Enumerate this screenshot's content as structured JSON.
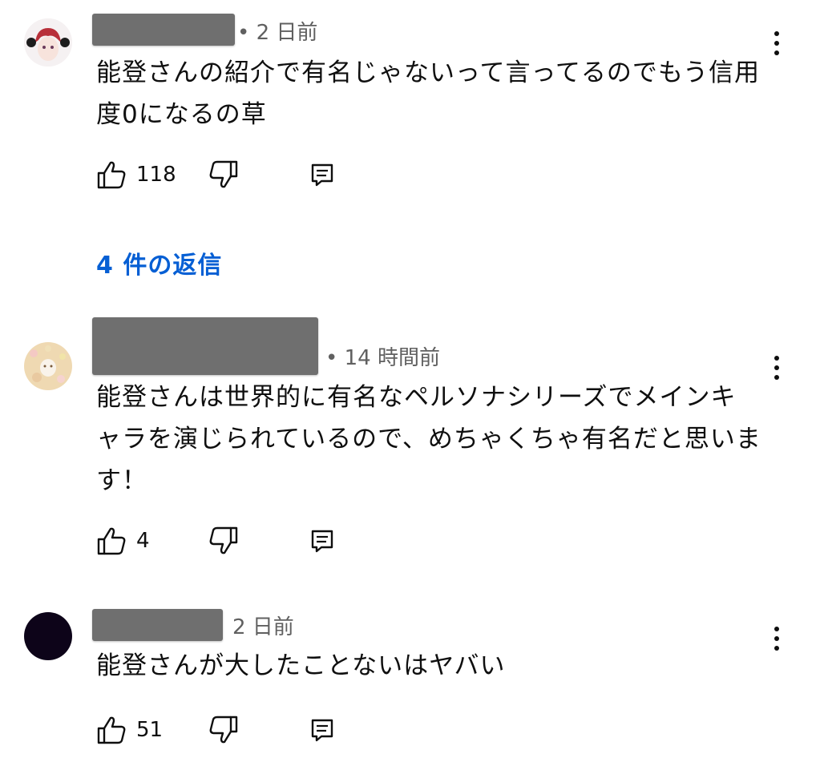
{
  "comments": [
    {
      "time": "• 2 日前",
      "text": "能登さんの紹介で有名じゃないって言ってるのでもう信用度0になるの草",
      "likes": "118"
    },
    {
      "time": "• 14 時間前",
      "text": "能登さんは世界的に有名なペルソナシリーズでメインキャラを演じられているので、めちゃくちゃ有名だと思います！",
      "likes": "4"
    },
    {
      "time": "2 日前",
      "text": "能登さんが大したことないはヤバい",
      "likes": "51"
    }
  ],
  "replies_label": "4 件の返信",
  "icons": {
    "like": "thumbs-up-icon",
    "dislike": "thumbs-down-icon",
    "reply": "reply-comment-icon",
    "more": "more-vert-icon"
  },
  "colors": {
    "link": "#065fd4",
    "meta": "#606060",
    "redaction": "#6f6f6f"
  }
}
